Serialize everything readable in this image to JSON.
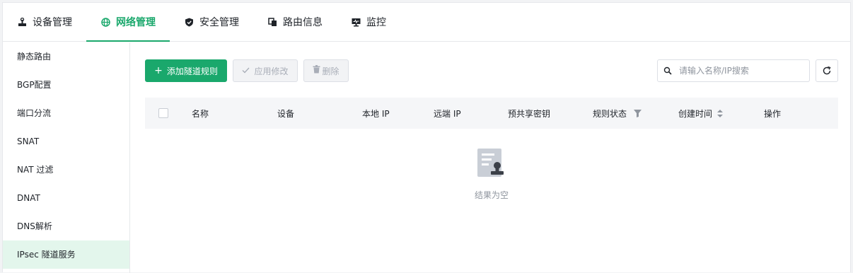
{
  "nav": {
    "tabs": [
      {
        "label": "设备管理",
        "icon": "device-icon",
        "active": false
      },
      {
        "label": "网络管理",
        "icon": "globe-icon",
        "active": true
      },
      {
        "label": "安全管理",
        "icon": "shield-icon",
        "active": false
      },
      {
        "label": "路由信息",
        "icon": "route-icon",
        "active": false
      },
      {
        "label": "监控",
        "icon": "monitor-icon",
        "active": false
      }
    ]
  },
  "sidebar": {
    "items": [
      {
        "label": "静态路由"
      },
      {
        "label": "BGP配置"
      },
      {
        "label": "端口分流"
      },
      {
        "label": "SNAT"
      },
      {
        "label": "NAT 过滤"
      },
      {
        "label": "DNAT"
      },
      {
        "label": "DNS解析"
      },
      {
        "label": "IPsec 隧道服务",
        "active": true
      }
    ]
  },
  "toolbar": {
    "add_label": "添加隧道规则",
    "apply_label": "应用修改",
    "delete_label": "删除"
  },
  "search": {
    "placeholder": "请输入名称/IP搜索",
    "value": ""
  },
  "table": {
    "columns": [
      "名称",
      "设备",
      "本地 IP",
      "远端 IP",
      "预共享密钥",
      "规则状态",
      "创建时间",
      "操作"
    ],
    "empty_text": "结果为空"
  },
  "colors": {
    "accent": "#1aa86c",
    "active_bg": "#e3f6ec",
    "header_bg": "#f5f6f8"
  }
}
